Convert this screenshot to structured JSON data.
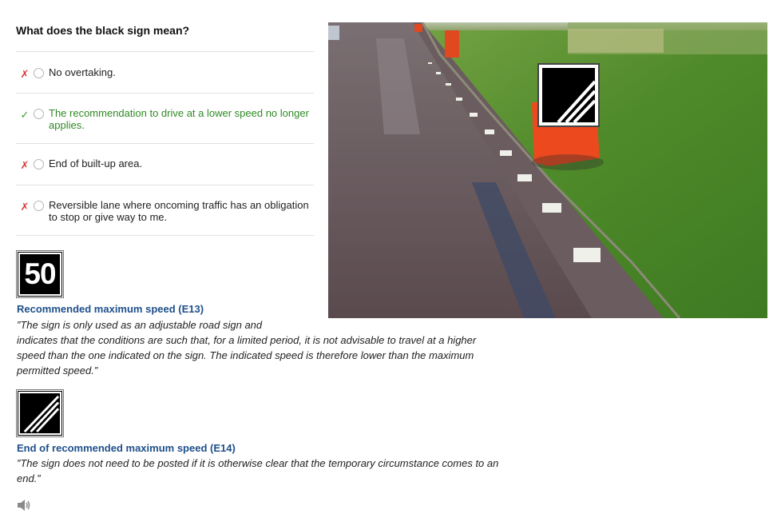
{
  "question": "What does the black sign mean?",
  "answers": [
    {
      "mark": "✗",
      "status": "wrong",
      "text": "No overtaking."
    },
    {
      "mark": "✓",
      "status": "correct",
      "text": "The recommendation to drive at a lower speed no longer applies."
    },
    {
      "mark": "✗",
      "status": "wrong",
      "text": "End of built-up area."
    },
    {
      "mark": "✗",
      "status": "wrong",
      "text": "Reversible lane where oncoming traffic has an obligation to stop or give way to me."
    }
  ],
  "signs": [
    {
      "icon_text": "50",
      "title": "Recommended maximum speed (E13)",
      "description_line1": "”The sign is only used as an adjustable road sign and",
      "description_line2": "indicates that the conditions are such that, for a limited period, it is not advisable to travel at a higher speed than the one indicated on the sign. The indicated speed is therefore lower than the maximum permitted speed.”"
    },
    {
      "title": "End of recommended maximum speed (E14)",
      "description": "”The sign does not need to be posted if it is otherwise clear that the temporary circumstance comes to an end.”"
    }
  ],
  "colors": {
    "correct": "#2f8a24",
    "wrong": "#d93a3a",
    "title": "#1e4f8a"
  },
  "icons": {
    "audio": "speaker-icon",
    "photo": "road-photo"
  }
}
